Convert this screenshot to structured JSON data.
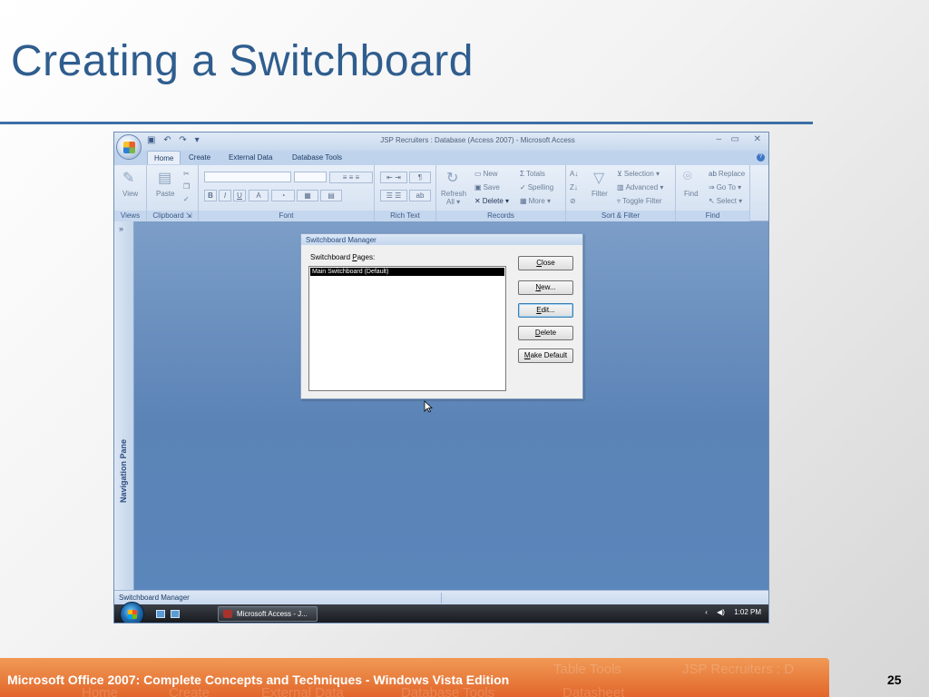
{
  "slide": {
    "title": "Creating a Switchboard",
    "footer": "Microsoft Office 2007: Complete Concepts and Techniques - Windows Vista Edition",
    "page_number": "25",
    "footer_ghost": [
      "Table Tools",
      "JSP Recruiters : D",
      "Home",
      "Create",
      "External Data",
      "Database Tools",
      "Datasheet"
    ]
  },
  "window": {
    "title": "JSP Recruiters : Database (Access 2007) - Microsoft Access",
    "quick_access": "▾",
    "controls": {
      "minimize": "–",
      "maximize": "▭",
      "close": "✕"
    }
  },
  "tabs": [
    "Home",
    "Create",
    "External Data",
    "Database Tools"
  ],
  "ribbon": {
    "groups": [
      "Views",
      "Clipboard",
      "Font",
      "Rich Text",
      "Records",
      "Sort & Filter",
      "Find"
    ],
    "views": {
      "view": "View"
    },
    "clipboard": {
      "paste": "Paste"
    },
    "font": {
      "bold": "B",
      "italic": "I",
      "underline": "U",
      "font_color": "A"
    },
    "records": {
      "refresh": "Refresh",
      "refresh_sub": "All ▾",
      "new": "New",
      "save": "Save",
      "delete": "Delete",
      "totals": "Totals",
      "spelling": "Spelling",
      "more": "More"
    },
    "sort_filter": {
      "filter": "Filter",
      "selection": "Selection",
      "advanced": "Advanced",
      "toggle_filter": "Toggle Filter"
    },
    "find": {
      "find": "Find",
      "replace": "Replace",
      "go_to": "Go To",
      "select": "Select"
    }
  },
  "nav_pane": {
    "label": "Navigation Pane",
    "chevron": "»"
  },
  "dialog": {
    "title": "Switchboard Manager",
    "list_label": "Switchboard Pages:",
    "items": [
      "Main Switchboard (Default)"
    ],
    "buttons": {
      "close": "Close",
      "new": "New...",
      "edit": "Edit...",
      "delete": "Delete",
      "make_default": "Make Default"
    }
  },
  "status_bar": {
    "text": "Switchboard Manager"
  },
  "taskbar": {
    "task": "Microsoft Access - J...",
    "tray_chevron": "‹",
    "volume": "◀)",
    "time": "1:02 PM"
  }
}
